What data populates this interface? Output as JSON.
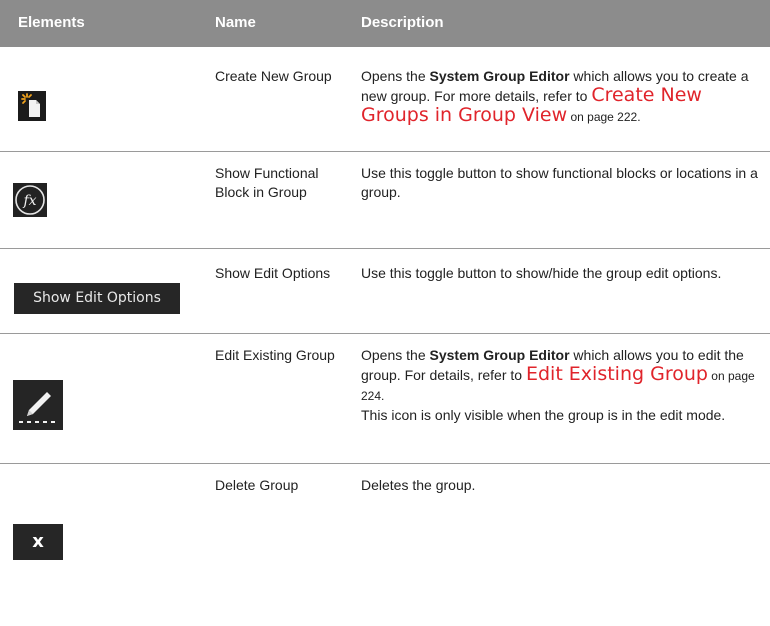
{
  "table": {
    "headers": [
      "Elements",
      "Name",
      "Description"
    ],
    "rows": [
      {
        "icon": "create-new-group-icon",
        "name": "Create New Group",
        "desc_p1": "Opens the ",
        "desc_bold": "System Group Editor",
        "desc_p2": " which allows you to create a new group. For more details, refer to ",
        "link": "Create New Groups in Group View",
        "page": " on page 222."
      },
      {
        "icon": "fx-icon",
        "icon_text": "fx",
        "name": "Show Functional Block in Group",
        "desc": "Use this toggle button to show functional blocks or locations in a group."
      },
      {
        "icon": "show-edit-options-button",
        "icon_text": "Show Edit Options",
        "name": "Show Edit Options",
        "desc": "Use this toggle button to show/hide the group edit options."
      },
      {
        "icon": "edit-pencil-icon",
        "name": "Edit Existing Group",
        "desc_p1": "Opens the ",
        "desc_bold": "System Group Editor",
        "desc_p2": " which allows you to edit the group. For details, refer to ",
        "link": "Edit Existing Group",
        "page": " on page 224.",
        "desc_note": "This icon is only visible when the group is in the edit mode."
      },
      {
        "icon": "close-x-icon",
        "icon_text": "x",
        "name": "Delete Group",
        "desc": "Deletes the group."
      }
    ]
  }
}
